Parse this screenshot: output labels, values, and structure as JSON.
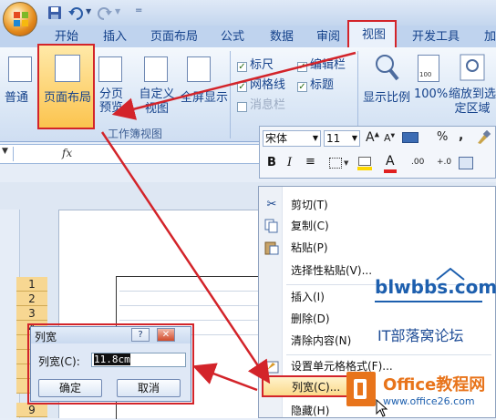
{
  "qat": {
    "dropdown_glyph": "▼",
    "separator": "="
  },
  "tabs": [
    "开始",
    "插入",
    "页面布局",
    "公式",
    "数据",
    "审阅",
    "视图",
    "开发工具",
    "加"
  ],
  "ribbon": {
    "workbook_views": {
      "items": [
        "普通",
        "页面布局",
        "分页预览",
        "自定义视图",
        "全屏显示"
      ],
      "group_label": "工作簿视图"
    },
    "show_hide": {
      "ruler": "标尺",
      "gridlines": "网格线",
      "message_bar": "消息栏",
      "formula_bar": "编辑栏",
      "headings": "标题"
    },
    "zoom": {
      "zoom": "显示比例",
      "zoom_100": "100%",
      "zoom_selection": "缩放到选定区域",
      "badge": "100"
    }
  },
  "formula_bar": {
    "fx": "fx"
  },
  "mini_toolbar": {
    "font": "宋体",
    "size": "11",
    "percent": "%",
    "comma": ",",
    "bold": "B",
    "italic": "I",
    "font_color": "A",
    "decimal_inc": ".00",
    "decimal_dec": "+.0"
  },
  "context_menu": {
    "items": [
      {
        "label": "剪切(T)",
        "icon": "scissors-icon"
      },
      {
        "label": "复制(C)",
        "icon": "copy-icon"
      },
      {
        "label": "粘贴(P)",
        "icon": "paste-icon"
      },
      {
        "label": "选择性粘贴(V)...",
        "icon": ""
      },
      {
        "label": "插入(I)",
        "icon": ""
      },
      {
        "label": "删除(D)",
        "icon": ""
      },
      {
        "label": "清除内容(N)",
        "icon": ""
      },
      {
        "label": "设置单元格格式(F)...",
        "icon": "format-cells-icon"
      },
      {
        "label": "列宽(C)...",
        "icon": ""
      },
      {
        "label": "隐藏(H)",
        "icon": ""
      }
    ]
  },
  "row_headers": [
    "1",
    "2",
    "3",
    "4",
    "9"
  ],
  "dialog": {
    "title": "列宽",
    "help": "?",
    "close": "✕",
    "label": "列宽(C):",
    "value": "11.8cm",
    "ok": "确定",
    "cancel": "取消"
  },
  "watermarks": {
    "site": "blwbbs.com",
    "forum": "IT部落窝论坛",
    "brand": "Office教程网",
    "url": "www.office26.com"
  },
  "colors": {
    "annotation_red": "#d3242a",
    "ribbon_blue": "#15428b",
    "office_orange": "#e8741b"
  }
}
